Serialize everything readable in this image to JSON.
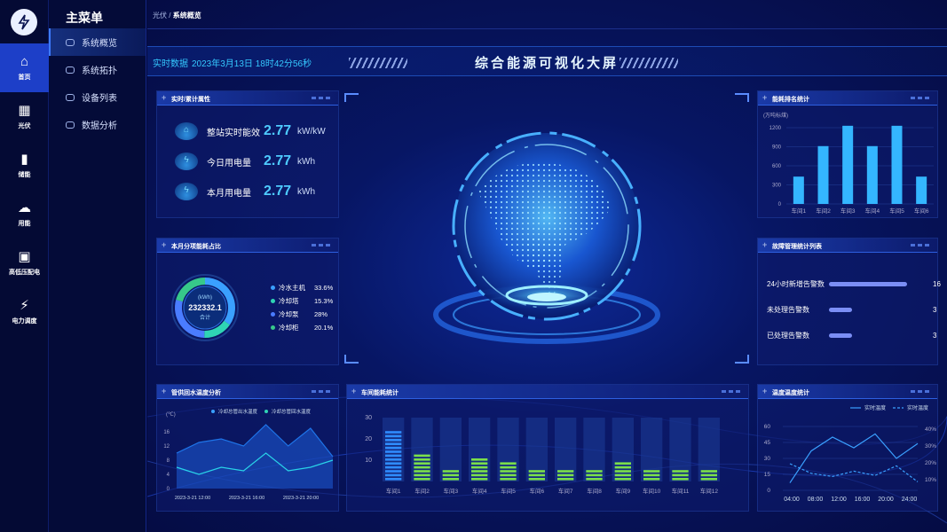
{
  "rail": {
    "items": [
      {
        "label": "首页",
        "icon": "home-icon",
        "glyph": "⌂",
        "active": true
      },
      {
        "label": "光伏",
        "icon": "solar-panel-icon",
        "glyph": "▦",
        "active": false
      },
      {
        "label": "储能",
        "icon": "battery-icon",
        "glyph": "▮",
        "active": false
      },
      {
        "label": "用能",
        "icon": "cloud-icon",
        "glyph": "☁",
        "active": false
      },
      {
        "label": "高低压配电",
        "icon": "switchgear-icon",
        "glyph": "▣",
        "active": false
      },
      {
        "label": "电力调度",
        "icon": "lightning-icon",
        "glyph": "⚡",
        "active": false
      }
    ]
  },
  "menu": {
    "title": "主菜单",
    "items": [
      {
        "label": "系统概览",
        "active": true
      },
      {
        "label": "系统拓扑",
        "active": false
      },
      {
        "label": "设备列表",
        "active": false
      },
      {
        "label": "数据分析",
        "active": false
      }
    ]
  },
  "breadcrumb": {
    "parent": "光伏",
    "sep": "/",
    "current": "系统概览"
  },
  "header": {
    "realtime_label": "实时数据",
    "datetime": "2023年3月13日  18时42分56秒",
    "title": "综合能源可视化大屏"
  },
  "kpi": {
    "title": "实时/累计属性",
    "items": [
      {
        "label": "整站实时能效",
        "value": "2.77",
        "unit": "kW/kW",
        "icon": "house-icon",
        "glyph": "⌂"
      },
      {
        "label": "今日用电量",
        "value": "2.77",
        "unit": "kWh",
        "icon": "bolt-icon",
        "glyph": "ϟ"
      },
      {
        "label": "本月用电量",
        "value": "2.77",
        "unit": "kWh",
        "icon": "bolt-icon",
        "glyph": "ϟ"
      }
    ]
  },
  "share": {
    "title": "本月分项能耗占比",
    "unit": "(kWh)",
    "total": "232332.1",
    "total_label": "合计",
    "items": [
      {
        "name": "冷水主机",
        "pct": "33.6%",
        "value": 33.6,
        "color": "#3aa0ff"
      },
      {
        "name": "冷却塔",
        "pct": "15.3%",
        "value": 15.3,
        "color": "#2fd4b4"
      },
      {
        "name": "冷却泵",
        "pct": "28%",
        "value": 28,
        "color": "#4a7cff"
      },
      {
        "name": "冷却柜",
        "pct": "20.1%",
        "value": 20.1,
        "color": "#37c88a"
      }
    ]
  },
  "rank": {
    "title": "能耗排名统计",
    "unit": "(万吨标煤)"
  },
  "faults": {
    "title": "故障管理统计列表",
    "items": [
      {
        "label": "24小时新增告警数",
        "value": 16
      },
      {
        "label": "未处理告警数",
        "value": 3
      },
      {
        "label": "已处理告警数",
        "value": 3
      }
    ]
  },
  "water": {
    "title": "管供回水温度分析",
    "unit": "(℃)",
    "legend": [
      "冷却总管出水温度",
      "冷却总管回水温度"
    ]
  },
  "workshop": {
    "title": "车间能耗统计"
  },
  "temp": {
    "title": "温度温度统计",
    "legend": [
      "实时温度",
      "实时温度"
    ]
  },
  "chart_data": [
    {
      "type": "bar",
      "title": "能耗排名统计",
      "categories": [
        "车间1",
        "车间2",
        "车间3",
        "车间4",
        "车间5",
        "车间6"
      ],
      "values": [
        430,
        910,
        1230,
        910,
        1230,
        430
      ],
      "ylim": [
        0,
        1200
      ],
      "yticks": [
        0,
        300,
        600,
        900,
        1200
      ]
    },
    {
      "type": "area",
      "title": "管供回水温度分析",
      "x": [
        "2023-3-21 12:00",
        "2023-3-21 16:00",
        "2023-3-21 20:00"
      ],
      "series": [
        {
          "name": "冷却总管出水温度",
          "values": [
            10,
            13,
            14,
            12,
            18,
            12,
            17,
            9
          ]
        },
        {
          "name": "冷却总管回水温度",
          "values": [
            6,
            4,
            6,
            5,
            10,
            5,
            6,
            8
          ]
        }
      ],
      "ylim": [
        0,
        16
      ],
      "yticks": [
        0,
        4,
        8,
        12,
        16
      ]
    },
    {
      "type": "bar",
      "title": "车间能耗统计",
      "categories": [
        "车间1",
        "车间2",
        "车间3",
        "车间4",
        "车间5",
        "车间6",
        "车间7",
        "车间8",
        "车间9",
        "车间10",
        "车间11",
        "车间12"
      ],
      "values": [
        28,
        15,
        7,
        12,
        10,
        7,
        7,
        7,
        10,
        7,
        7,
        7
      ],
      "ylim": [
        0,
        30
      ],
      "yticks": [
        10,
        20,
        30
      ]
    },
    {
      "type": "line",
      "title": "温度温度统计",
      "x": [
        "04:00",
        "08:00",
        "12:00",
        "16:00",
        "20:00",
        "24:00"
      ],
      "series": [
        {
          "name": "实时温度",
          "values": [
            7,
            37,
            50,
            40,
            53,
            30,
            44
          ]
        },
        {
          "name": "实时温度",
          "values": [
            25,
            16,
            13,
            18,
            14,
            23,
            8
          ]
        }
      ],
      "ylim": [
        0,
        60
      ],
      "yticks": [
        0,
        15,
        30,
        45,
        60
      ],
      "y2ticks": [
        "10%",
        "20%",
        "30%",
        "40%"
      ]
    }
  ]
}
